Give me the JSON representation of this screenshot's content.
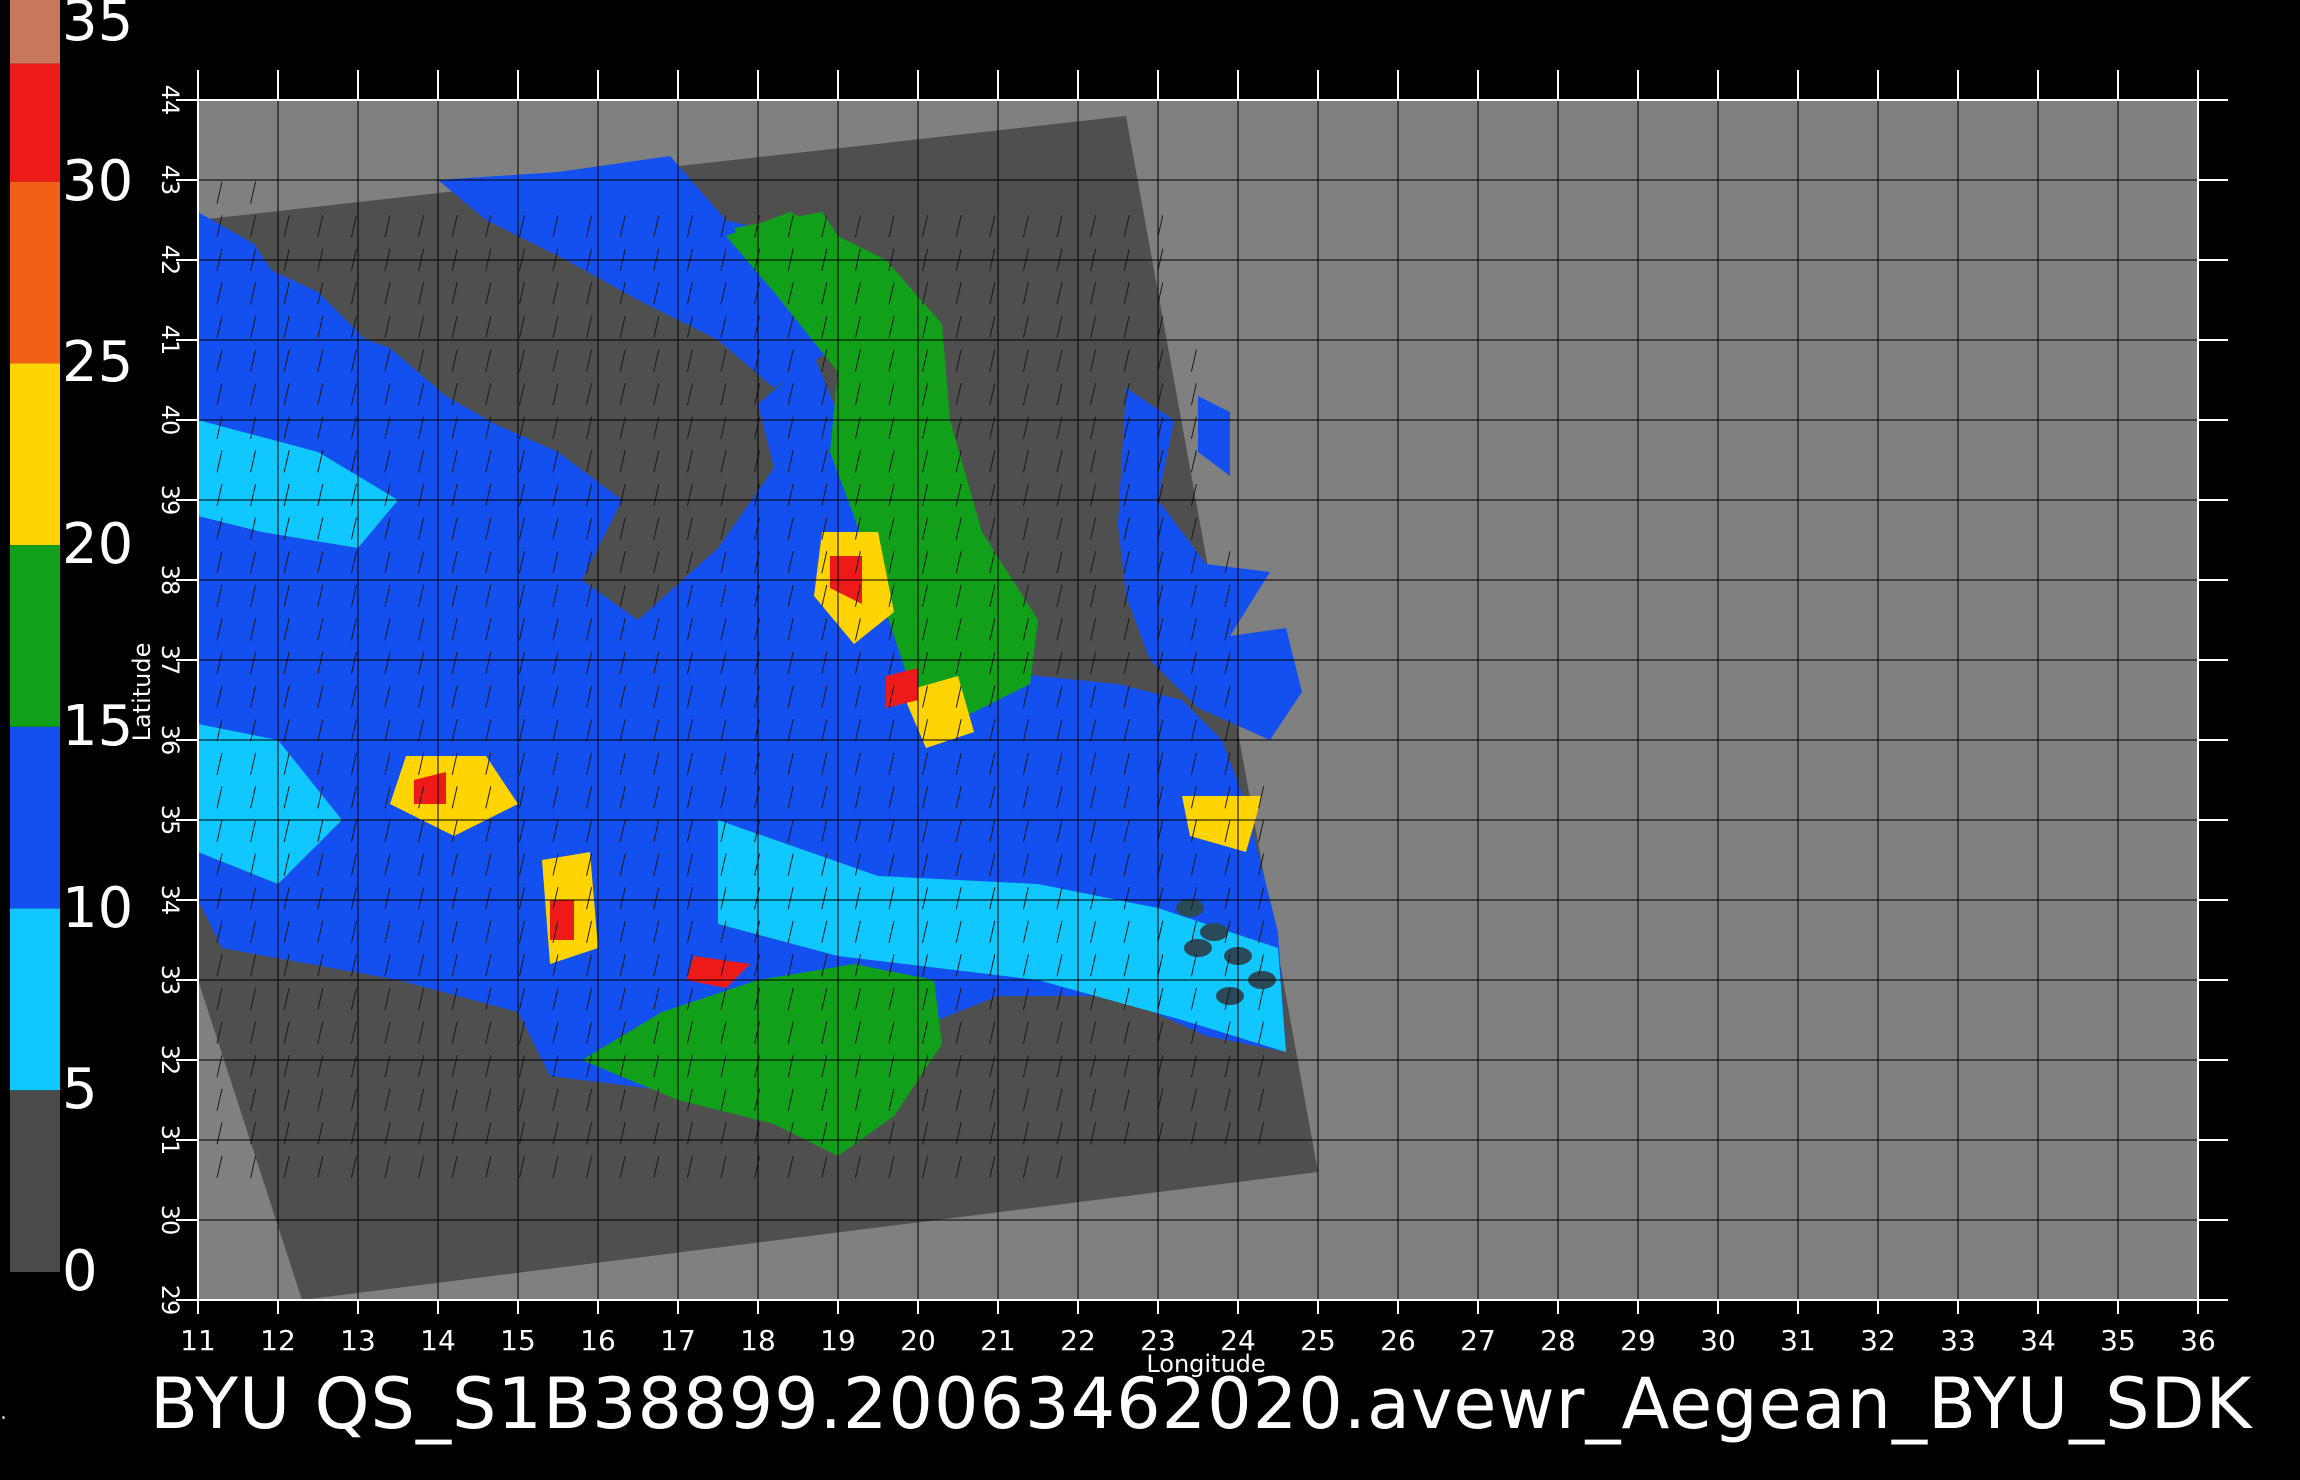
{
  "colorbar": {
    "labels": [
      "35",
      "30",
      "25",
      "20",
      "15",
      "10",
      "5",
      "0"
    ],
    "min": 0,
    "max": 35,
    "stops": [
      {
        "from": 33.25,
        "to": 35,
        "color": "#c8785a"
      },
      {
        "from": 30,
        "to": 33.25,
        "color": "#ee1a1a"
      },
      {
        "from": 25,
        "to": 30,
        "color": "#f26018"
      },
      {
        "from": 20,
        "to": 25,
        "color": "#ffd400"
      },
      {
        "from": 15,
        "to": 20,
        "color": "#12a01a"
      },
      {
        "from": 10,
        "to": 15,
        "color": "#1450f0"
      },
      {
        "from": 5,
        "to": 10,
        "color": "#10c8ff"
      },
      {
        "from": 0,
        "to": 5,
        "color": "#4a4a4a"
      }
    ]
  },
  "map": {
    "lon_ticks": [
      "11",
      "12",
      "13",
      "14",
      "15",
      "16",
      "17",
      "18",
      "19",
      "20",
      "21",
      "22",
      "23",
      "24",
      "25",
      "26",
      "27",
      "28",
      "29",
      "30",
      "31",
      "32",
      "33",
      "34",
      "35",
      "36"
    ],
    "lat_ticks": [
      "29",
      "30",
      "31",
      "32",
      "33",
      "34",
      "35",
      "36",
      "37",
      "38",
      "39",
      "40",
      "41",
      "42",
      "43",
      "44"
    ],
    "lon_range": [
      11,
      36
    ],
    "lat_range": [
      29,
      44
    ],
    "xlabel": "Longitude",
    "ylabel": "Latitude",
    "colors": {
      "background": "#808080",
      "swath": "#4f4f4f",
      "grid": "#000000",
      "frame": "#ffffff",
      "low_wind": "#10c8ff",
      "mid_wind": "#1450f0",
      "moderate_wind": "#12a01a",
      "high_wind": "#ffd400",
      "very_high_wind": "#ee1a1a"
    }
  },
  "caption": "BYU  QS_S1B38899.20063462020.avewr_Aegean_BYU_SDK",
  "edge_glyph": "."
}
